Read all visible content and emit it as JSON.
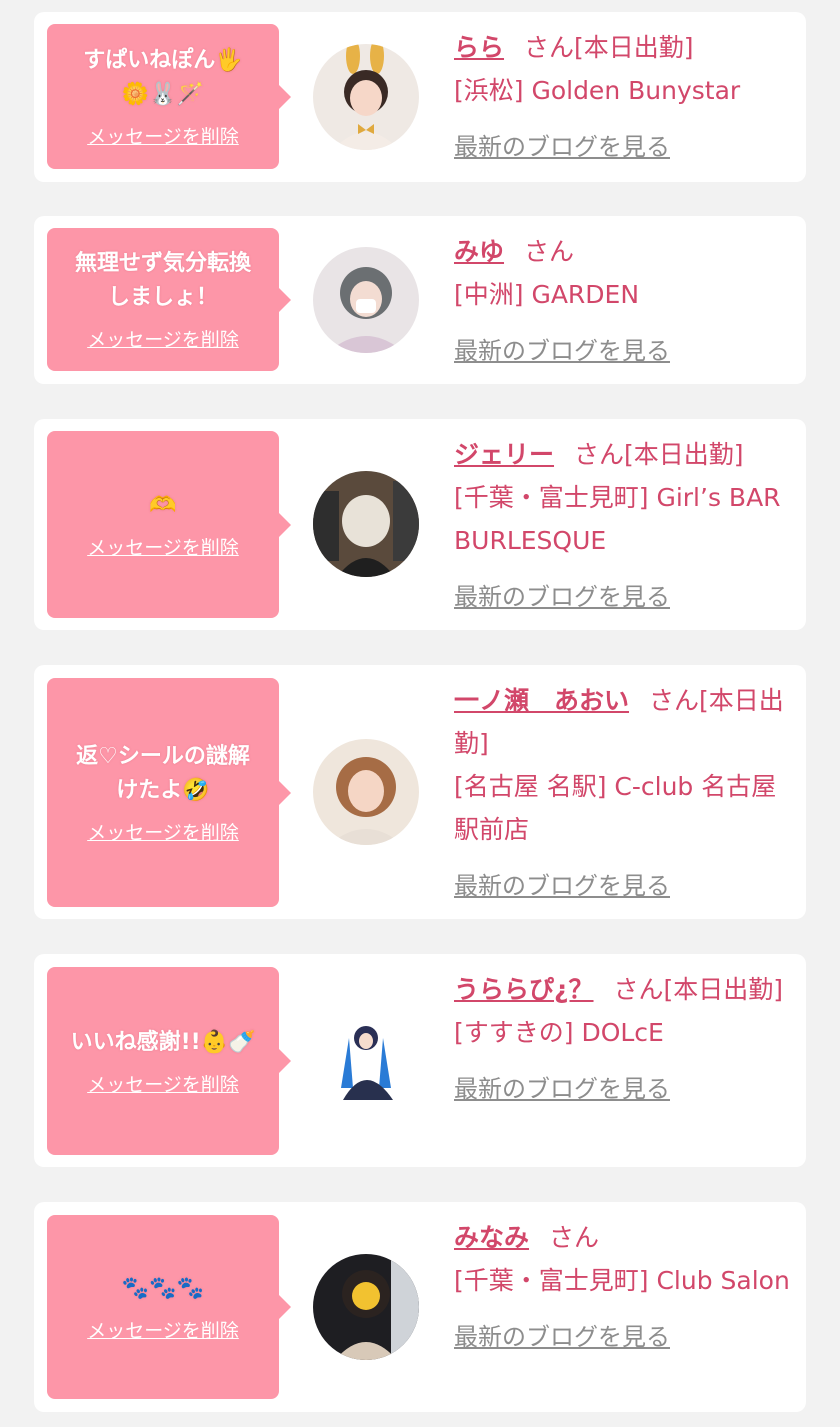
{
  "common": {
    "delete_label": "メッセージを削除",
    "blog_label": "最新のブログを見る",
    "san": "さん",
    "colors": {
      "page_bg": "#f2f2f2",
      "bubble_pink": "#fd96a8",
      "name_text": "#d2476a",
      "blog_link": "#8d8d8d"
    }
  },
  "cards": [
    {
      "message": "すぱいねぽん🖐️\n🌼🐰🪄",
      "name": "らら",
      "suffix": "さん[本日出勤]",
      "store": "[浜松] Golden Bunystar"
    },
    {
      "message": "無理せず気分転換\nしましょ！",
      "name": "みゆ",
      "suffix": "さん",
      "store": "[中洲] GARDEN"
    },
    {
      "message": "🫶",
      "name": "ジェリー",
      "suffix": "さん[本日出勤]",
      "store": "[千葉・富士見町] Girl’s BAR BURLESQUE"
    },
    {
      "message": "返♡シールの謎解\nけたよ🤣",
      "name": "一ノ瀬　あおい",
      "suffix": "さん[本日出勤]",
      "store": "[名古屋 名駅] C-club 名古屋駅前店"
    },
    {
      "message": "いいね感謝!!👶🍼",
      "name": "うららぴ¿？",
      "suffix": "さん[本日出勤]",
      "store": "[すすきの] DOLcE"
    },
    {
      "message": "🐾🐾🐾",
      "name": "みなみ",
      "suffix": "さん",
      "store": "[千葉・富士見町] Club Salon"
    }
  ]
}
